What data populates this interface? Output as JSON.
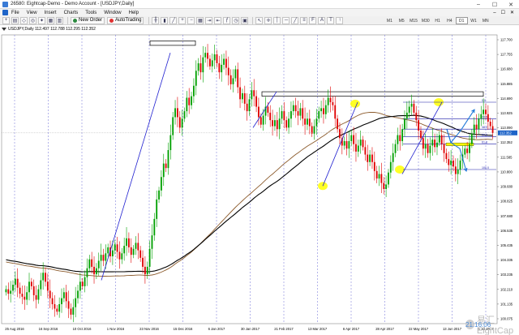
{
  "window": {
    "title": "26580: Eightcap-Demo - Demo Account - [USDJPY,Daily]",
    "controls": [
      "–",
      "☐",
      "✕"
    ]
  },
  "menu": {
    "items": [
      "File",
      "View",
      "Insert",
      "Charts",
      "Tools",
      "Window",
      "Help"
    ],
    "right_items": [
      "–",
      "☐",
      "✕"
    ]
  },
  "toolbar": {
    "new_order_label": "New Order",
    "autotrading_label": "AutoTrading"
  },
  "timeframes": [
    {
      "label": "M1",
      "active": false
    },
    {
      "label": "M5",
      "active": false
    },
    {
      "label": "M15",
      "active": false
    },
    {
      "label": "M30",
      "active": false
    },
    {
      "label": "H1",
      "active": false
    },
    {
      "label": "H4",
      "active": false
    },
    {
      "label": "D1",
      "active": true
    },
    {
      "label": "W1",
      "active": false
    },
    {
      "label": "MN",
      "active": false
    }
  ],
  "chart_header": "USDJPY,Daily  112.497 112.788 112.295 112.352",
  "price_labels": [
    "117.700",
    "117.755",
    "116.680",
    "115.885",
    "114.690",
    "113.925",
    "113.090",
    "112.352",
    "111.585",
    "110.800",
    "109.680",
    "108.825",
    "107.680",
    "106.535",
    "105.435",
    "104.335",
    "103.235",
    "102.210",
    "101.135",
    "100.075"
  ],
  "current_price": "112.352",
  "fib_labels": [
    "0.0",
    "23.6",
    "38.2",
    "50.0",
    "61.8",
    "100.0"
  ],
  "date_labels": [
    "25 Aug 2016",
    "16 Sep 2016",
    "10 Oct 2016",
    "1 Nov 2016",
    "23 Nov 2016",
    "15 Dec 2016",
    "6 Jan 2017",
    "30 Jan 2017",
    "21 Feb 2017",
    "13 Mar 2017",
    "6 Apr 2017",
    "28 Apr 2017",
    "22 May 2017",
    "13 Jun 2017",
    "5 Jul 2017"
  ],
  "watermark": "易汇EightCap",
  "timestamp": "21:16:06",
  "colors": {
    "bull": "#00a000",
    "bear": "#e00000",
    "ma_black": "#000000",
    "ma_brown": "#8b5a2b",
    "trend": "#2020d0",
    "highlight": "#ffff00",
    "grid_v": "#6b6bd6",
    "current_price_bg": "#1e64c8"
  },
  "chart_data": {
    "type": "candlestick",
    "symbol": "USDJPY",
    "timeframe": "Daily",
    "ylim": [
      99.6,
      118.9
    ],
    "closes": [
      101.9,
      101.6,
      101.8,
      102.2,
      102.6,
      102.0,
      101.6,
      101.4,
      101.2,
      101.7,
      102.4,
      102.1,
      101.5,
      101.2,
      101.9,
      102.5,
      103.0,
      102.4,
      101.8,
      101.3,
      100.9,
      100.6,
      100.4,
      100.9,
      101.3,
      101.7,
      101.1,
      100.6,
      100.2,
      100.7,
      101.3,
      101.8,
      102.4,
      102.1,
      102.7,
      103.3,
      103.9,
      103.4,
      102.9,
      103.3,
      103.8,
      104.2,
      103.8,
      104.3,
      104.7,
      104.1,
      104.5,
      104.9,
      104.4,
      103.9,
      104.3,
      104.8,
      105.3,
      104.7,
      104.2,
      104.6,
      105.0,
      104.5,
      104.0,
      103.4,
      102.9,
      103.4,
      104.6,
      105.5,
      106.6,
      107.9,
      108.5,
      109.4,
      110.3,
      110.0,
      111.2,
      112.2,
      113.4,
      114.0,
      113.4,
      112.7,
      113.3,
      113.8,
      114.7,
      114.2,
      114.8,
      115.5,
      116.5,
      117.0,
      116.4,
      117.4,
      117.7,
      117.3,
      116.8,
      117.2,
      117.6,
      117.0,
      116.4,
      116.9,
      117.3,
      116.7,
      116.2,
      115.6,
      116.0,
      116.6,
      115.4,
      114.6,
      115.0,
      114.3,
      113.8,
      114.6,
      115.2,
      114.8,
      114.1,
      113.4,
      112.9,
      113.5,
      114.1,
      113.7,
      113.2,
      112.8,
      113.2,
      112.6,
      113.3,
      113.8,
      113.2,
      112.7,
      113.3,
      113.8,
      114.2,
      113.8,
      113.5,
      114.0,
      113.3,
      112.9,
      113.3,
      112.8,
      112.3,
      112.8,
      113.3,
      113.8,
      114.0,
      113.6,
      114.2,
      114.7,
      114.4,
      114.2,
      113.3,
      112.6,
      112.0,
      111.5,
      111.8,
      111.3,
      111.8,
      112.2,
      111.6,
      111.1,
      111.5,
      111.9,
      111.4,
      110.9,
      110.4,
      110.9,
      110.4,
      109.8,
      109.3,
      109.6,
      109.0,
      108.6,
      108.9,
      109.7,
      110.4,
      111.0,
      111.6,
      112.2,
      111.8,
      112.6,
      113.3,
      113.7,
      114.1,
      114.3,
      113.7,
      113.2,
      112.5,
      112.0,
      111.3,
      111.6,
      111.0,
      111.5,
      111.9,
      111.4,
      111.7,
      112.2,
      111.6,
      111.0,
      110.6,
      110.2,
      110.5,
      110.1,
      109.6,
      109.9,
      110.5,
      110.9,
      111.3,
      111.0,
      111.6,
      112.3,
      112.9,
      112.6,
      113.3,
      113.6,
      113.9,
      113.6,
      113.1,
      112.8,
      112.35
    ],
    "fib_levels": [
      {
        "label": "0.0",
        "price": 114.4
      },
      {
        "label": "23.6",
        "price": 113.3
      },
      {
        "label": "38.2",
        "price": 112.6
      },
      {
        "label": "50.0",
        "price": 112.1
      },
      {
        "label": "61.8",
        "price": 111.6
      },
      {
        "label": "100.0",
        "price": 109.9
      }
    ],
    "resistance_boxes": [
      {
        "price_top": 118.5,
        "price_bottom": 118.2
      },
      {
        "price_top": 115.1,
        "price_bottom": 114.8
      }
    ]
  }
}
